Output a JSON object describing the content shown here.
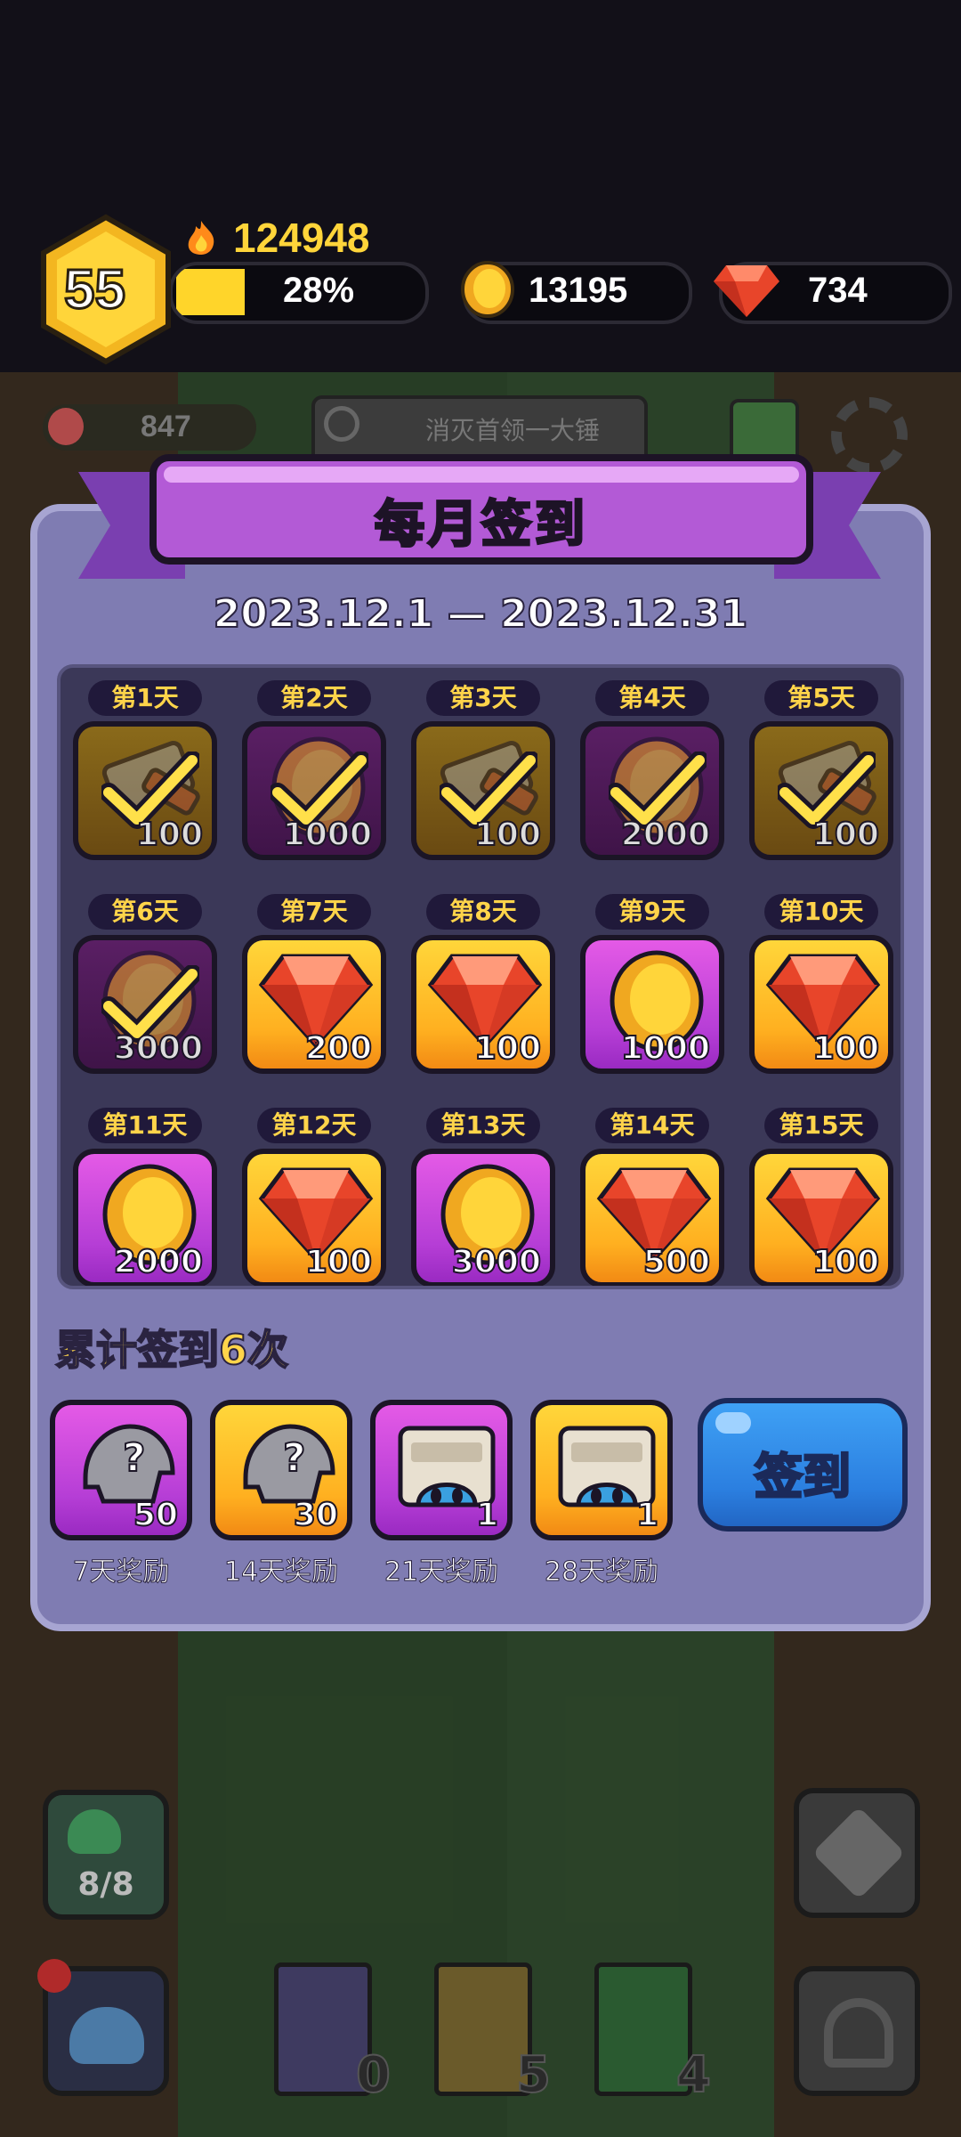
{
  "header": {
    "level": "55",
    "power": "124948",
    "exp_percent": "28%",
    "exp_fraction": 0.28,
    "coins": "13195",
    "gems": "734"
  },
  "background": {
    "meat": "847",
    "notice": "消灭首领一大锤",
    "squad": "8/8",
    "books": [
      "0",
      "5",
      "4"
    ]
  },
  "dialog": {
    "title": "每月签到",
    "date_range": "2023.12.1 — 2023.12.31",
    "cumulative": "累计签到6次",
    "button_label": "签到",
    "days": [
      {
        "label": "第1天",
        "amount": "100",
        "item": "hammer",
        "frame": "gold",
        "claimed": true
      },
      {
        "label": "第2天",
        "amount": "1000",
        "item": "coin",
        "frame": "purple",
        "claimed": true
      },
      {
        "label": "第3天",
        "amount": "100",
        "item": "hammer",
        "frame": "gold",
        "claimed": true
      },
      {
        "label": "第4天",
        "amount": "2000",
        "item": "coin",
        "frame": "purple",
        "claimed": true
      },
      {
        "label": "第5天",
        "amount": "100",
        "item": "hammer",
        "frame": "gold",
        "claimed": true
      },
      {
        "label": "第6天",
        "amount": "3000",
        "item": "coin",
        "frame": "purple",
        "claimed": true
      },
      {
        "label": "第7天",
        "amount": "200",
        "item": "gem",
        "frame": "gold",
        "claimed": false
      },
      {
        "label": "第8天",
        "amount": "100",
        "item": "gem",
        "frame": "gold",
        "claimed": false
      },
      {
        "label": "第9天",
        "amount": "1000",
        "item": "coin",
        "frame": "purple",
        "claimed": false
      },
      {
        "label": "第10天",
        "amount": "100",
        "item": "gem",
        "frame": "gold",
        "claimed": false
      },
      {
        "label": "第11天",
        "amount": "2000",
        "item": "coin",
        "frame": "purple",
        "claimed": false
      },
      {
        "label": "第12天",
        "amount": "100",
        "item": "gem",
        "frame": "gold",
        "claimed": false
      },
      {
        "label": "第13天",
        "amount": "3000",
        "item": "coin",
        "frame": "purple",
        "claimed": false
      },
      {
        "label": "第14天",
        "amount": "500",
        "item": "gem",
        "frame": "gold",
        "claimed": false
      },
      {
        "label": "第15天",
        "amount": "100",
        "item": "gem",
        "frame": "gold",
        "claimed": false
      }
    ],
    "milestones": [
      {
        "label": "7天奖励",
        "amount": "50",
        "item": "mystery-helmet",
        "frame": "purple"
      },
      {
        "label": "14天奖励",
        "amount": "30",
        "item": "mystery-helmet",
        "frame": "gold"
      },
      {
        "label": "21天奖励",
        "amount": "1",
        "item": "chest",
        "frame": "purple"
      },
      {
        "label": "28天奖励",
        "amount": "1",
        "item": "chest",
        "frame": "gold"
      }
    ]
  },
  "colors": {
    "gold": "#ffc22a",
    "purple": "#c44ad8",
    "button_blue": "#2b7fe0",
    "dialog_bg": "#7f7cb2"
  }
}
